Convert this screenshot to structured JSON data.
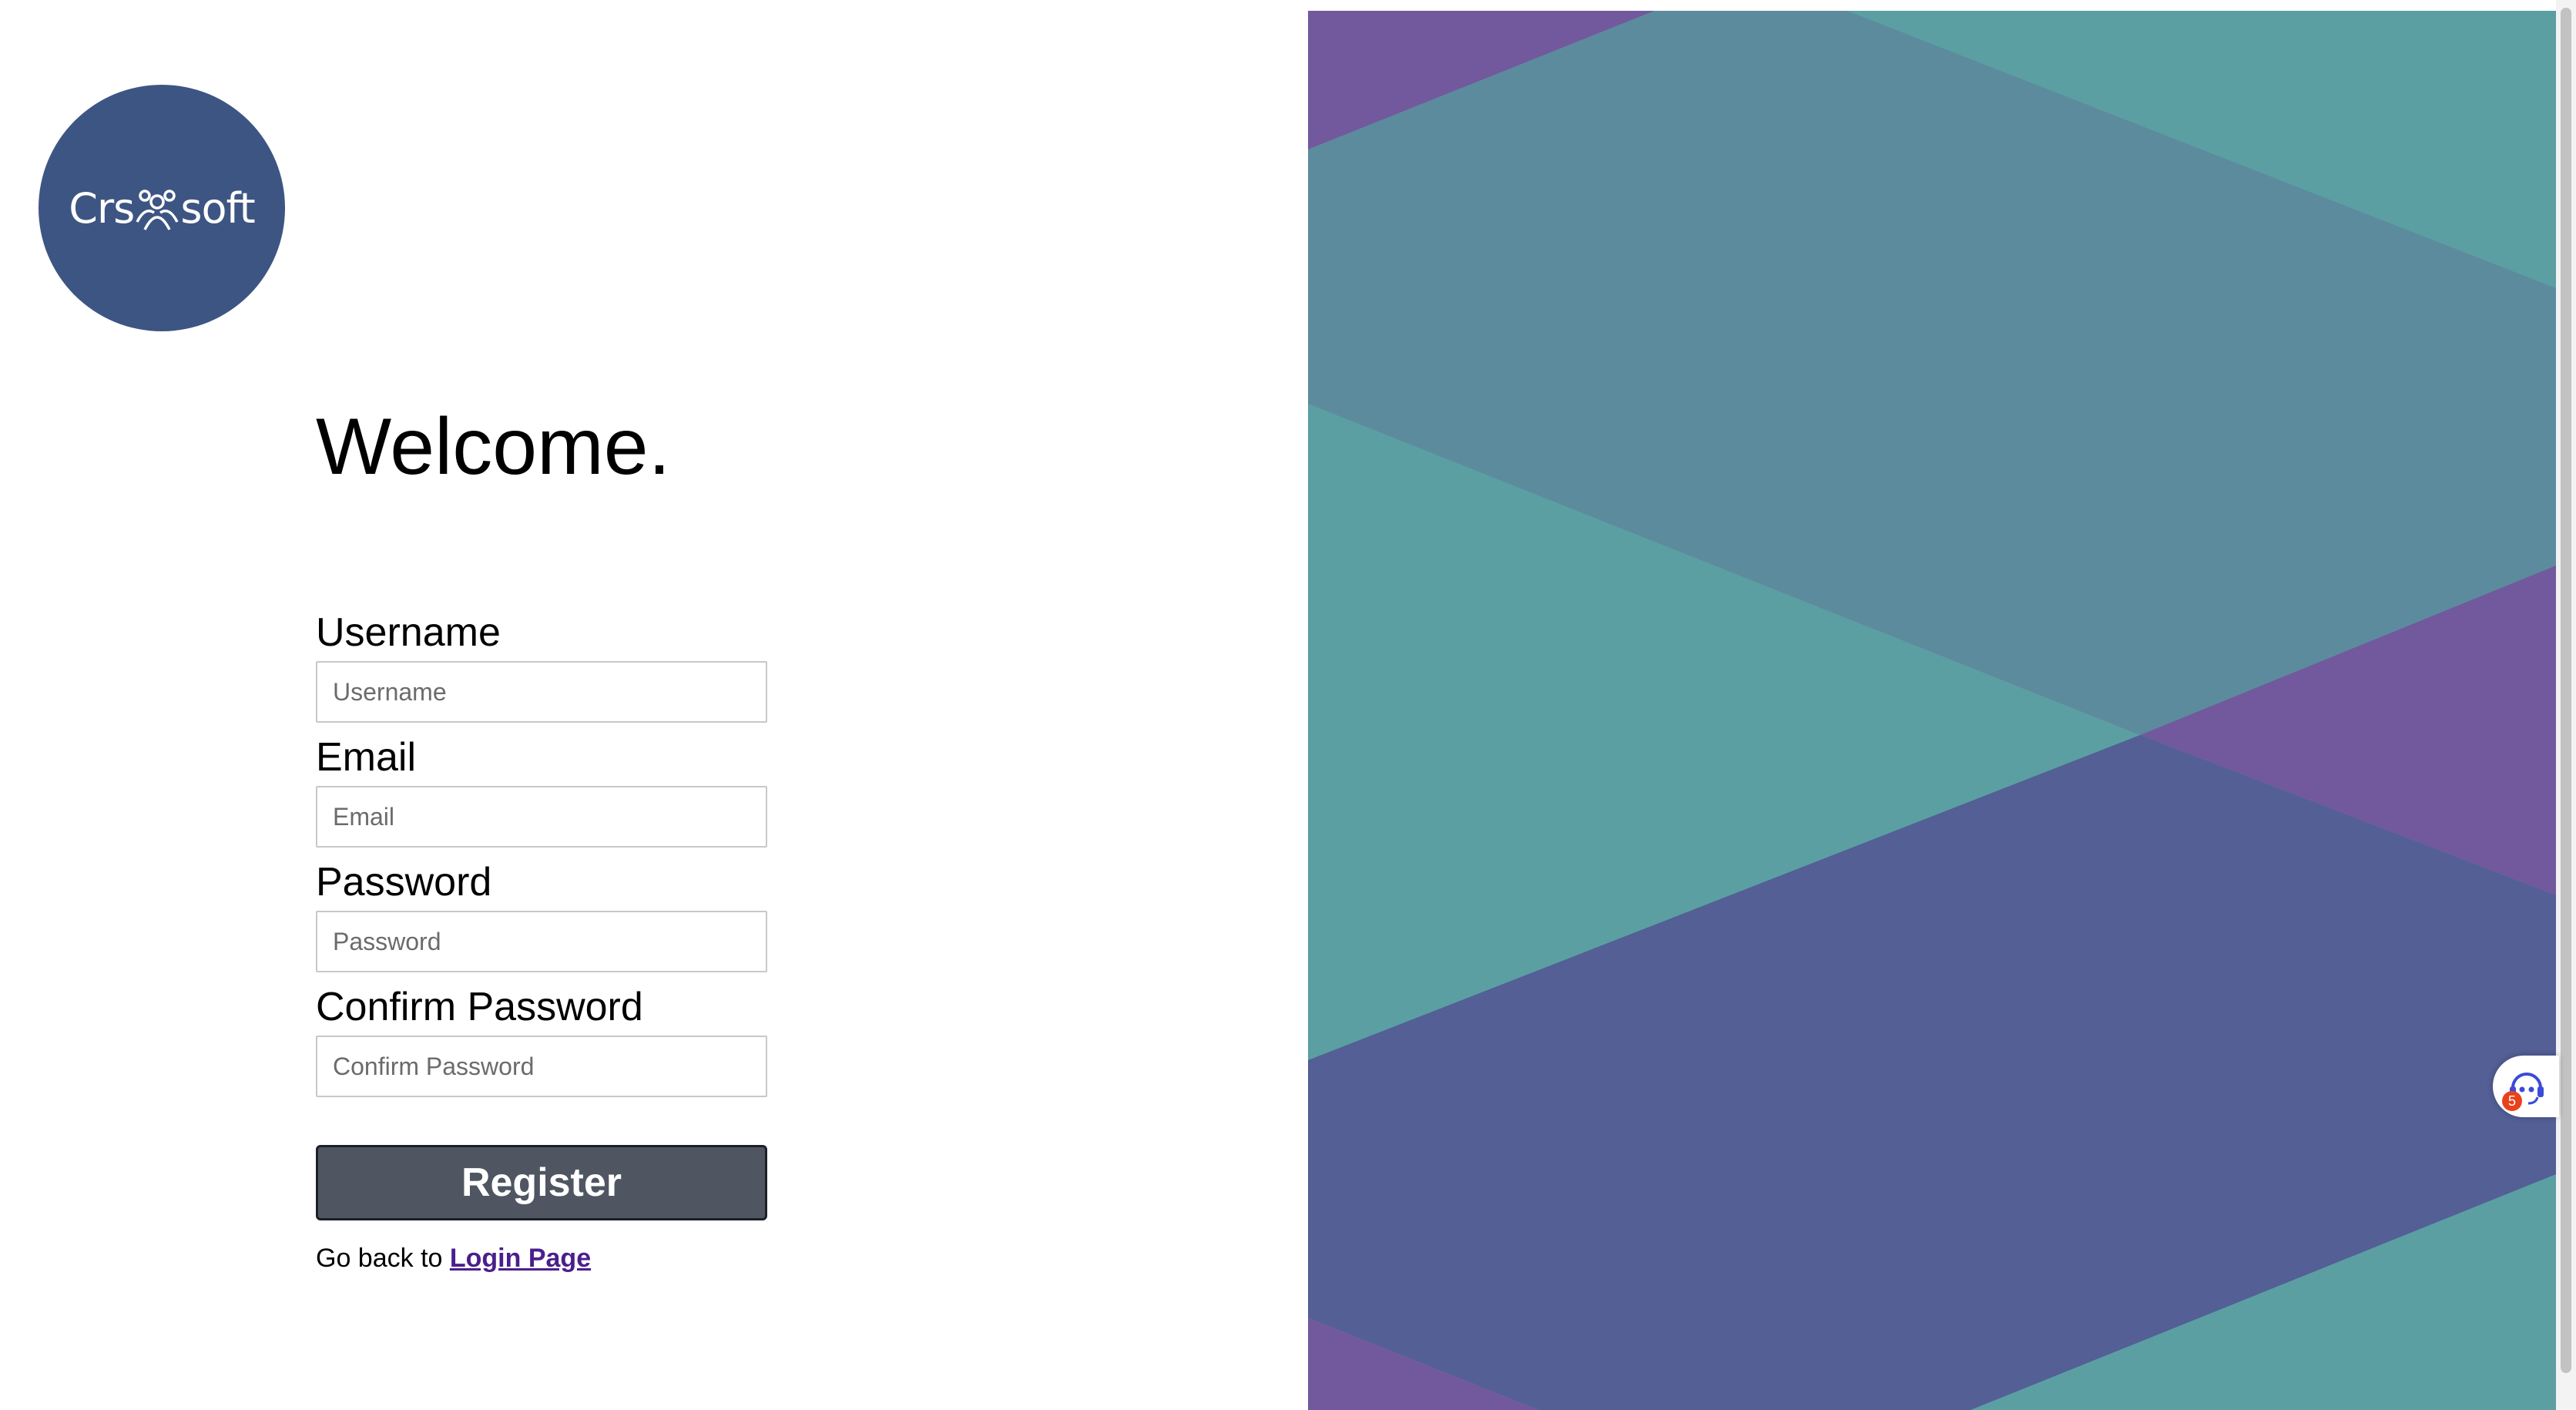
{
  "logo": {
    "text_left": "Crs",
    "text_right": "soft",
    "background": "#3d5583"
  },
  "heading": "Welcome.",
  "form": {
    "username": {
      "label": "Username",
      "placeholder": "Username",
      "value": ""
    },
    "email": {
      "label": "Email",
      "placeholder": "Email",
      "value": ""
    },
    "password": {
      "label": "Password",
      "placeholder": "Password",
      "value": ""
    },
    "confirm_password": {
      "label": "Confirm Password",
      "placeholder": "Confirm Password",
      "value": ""
    },
    "register_label": "Register"
  },
  "footer": {
    "prefix": "Go back to",
    "link_label": "Login Page"
  },
  "support_widget": {
    "icon": "support-headset-icon",
    "badge_count": "5"
  },
  "colors": {
    "teal": "#5b9fa3",
    "slate_teal": "#5d8b9e",
    "purple": "#72599d",
    "indigo": "#535f95",
    "button": "#4f5662",
    "link": "#4a1f8c"
  }
}
